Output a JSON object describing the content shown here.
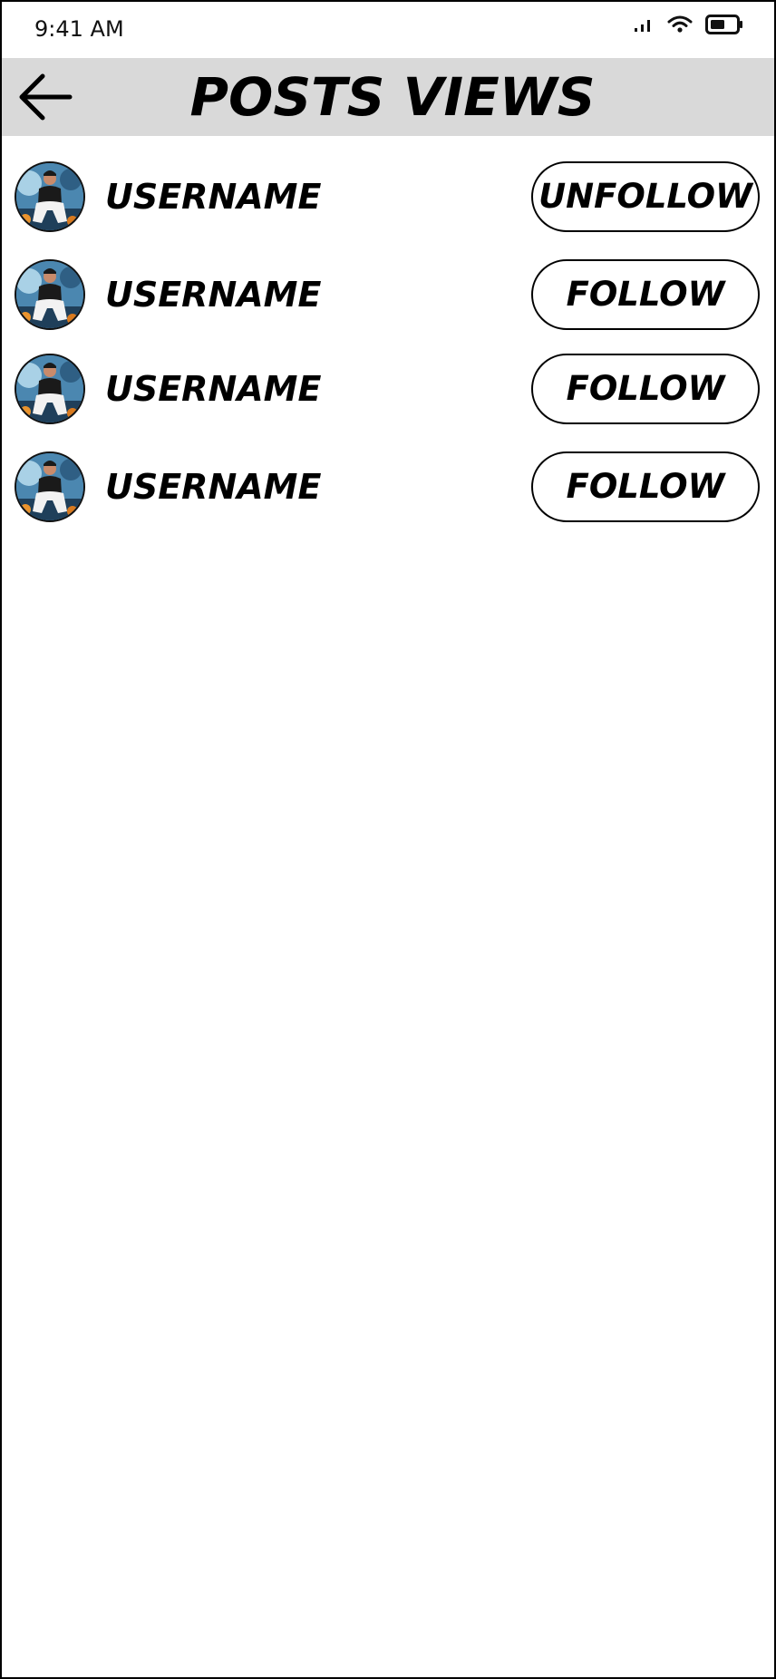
{
  "status_bar": {
    "time": "9:41 AM",
    "icons": [
      "signal-icon",
      "wifi-icon",
      "battery-icon"
    ]
  },
  "header": {
    "back_icon": "arrow-left-icon",
    "title": "POSTS VIEWS",
    "background": "#d9d9d9"
  },
  "viewers": [
    {
      "username": "USERNAME",
      "button_label": "UNFOLLOW"
    },
    {
      "username": "USERNAME",
      "button_label": "FOLLOW"
    },
    {
      "username": "USERNAME",
      "button_label": "FOLLOW"
    },
    {
      "username": "USERNAME",
      "button_label": "FOLLOW"
    }
  ]
}
